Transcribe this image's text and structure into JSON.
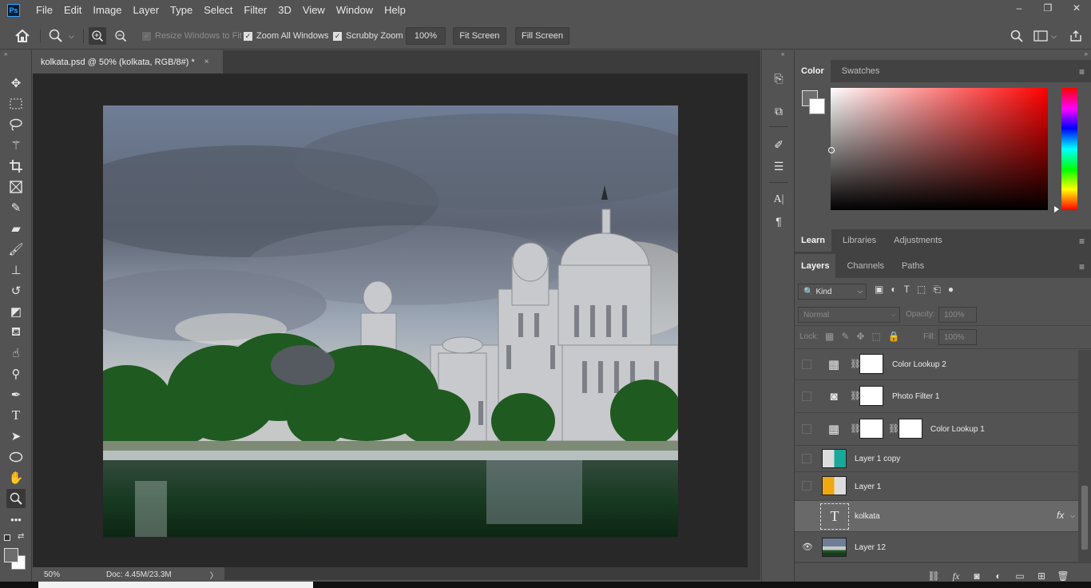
{
  "menu": {
    "logo": "Ps",
    "items": [
      "File",
      "Edit",
      "Image",
      "Layer",
      "Type",
      "Select",
      "Filter",
      "3D",
      "View",
      "Window",
      "Help"
    ],
    "window_controls": {
      "minimize": "–",
      "restore": "❐",
      "close": "✕"
    }
  },
  "options_bar": {
    "resize_windows_label": "Resize Windows to Fit",
    "zoom_all_windows_label": "Zoom All Windows",
    "scrubby_zoom_label": "Scrubby Zoom",
    "zoom_value": "100%",
    "fit_screen_label": "Fit Screen",
    "fill_screen_label": "Fill Screen"
  },
  "document": {
    "tab_title": "kolkata.psd @ 50% (kolkata, RGB/8#) *",
    "close_glyph": "×"
  },
  "status": {
    "zoom": "50%",
    "doc_size": "Doc: 4.45M/23.3M",
    "arrow": "〉"
  },
  "color_panel": {
    "tabs": [
      "Color",
      "Swatches"
    ],
    "foreground": "#6d6d6d",
    "background": "#ffffff",
    "hue": "#ff0000"
  },
  "learn_panel": {
    "tabs": [
      "Learn",
      "Libraries",
      "Adjustments"
    ]
  },
  "layers_panel": {
    "tabs": [
      "Layers",
      "Channels",
      "Paths"
    ],
    "filter_kind": "Kind",
    "blend_mode": "Normal",
    "opacity_label": "Opacity:",
    "opacity_value": "100%",
    "lock_label": "Lock:",
    "fill_label": "Fill:",
    "fill_value": "100%",
    "layers": [
      {
        "name": "Color Lookup 2",
        "type": "adjustment",
        "icon": "grid-icon",
        "visible": false
      },
      {
        "name": "Photo Filter 1",
        "type": "adjustment",
        "icon": "camera-icon",
        "visible": false
      },
      {
        "name": "Color Lookup 1",
        "type": "adjustment",
        "icon": "grid-icon",
        "visible": false
      },
      {
        "name": "Layer 1 copy",
        "type": "pixel",
        "swatch": "#1aa89a",
        "visible": false
      },
      {
        "name": "Layer 1",
        "type": "pixel",
        "swatch": "#f0a812",
        "visible": false
      },
      {
        "name": "kolkata",
        "type": "text",
        "selected": true,
        "fx": "fx",
        "visible": false
      },
      {
        "name": "Layer 12",
        "type": "image",
        "visible": true
      }
    ]
  }
}
